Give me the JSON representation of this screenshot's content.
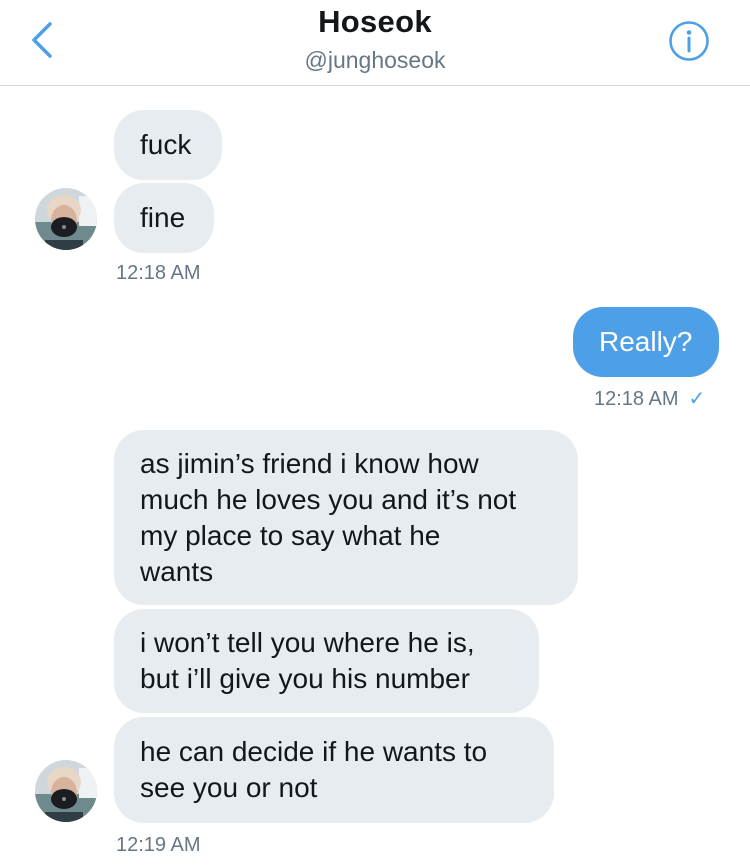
{
  "header": {
    "name": "Hoseok",
    "handle": "@junghoseok"
  },
  "colors": {
    "accent": "#4da0e8",
    "incoming_bubble": "#e6ecf0",
    "timestamp": "#657786"
  },
  "messages": {
    "group1": {
      "bubbles": [
        "fuck",
        "fine"
      ],
      "time": "12:18 AM"
    },
    "group2": {
      "bubbles": [
        "Really?"
      ],
      "time": "12:18 AM",
      "status": "✓"
    },
    "group3": {
      "bubbles": [
        [
          "as jimin’s friend i know how",
          "much he loves you and it’s not",
          "my place to say what he",
          "wants"
        ],
        [
          "i won’t tell you where he is,",
          "but i’ll give you his number"
        ],
        [
          "he can decide if he wants to",
          "see you or not"
        ]
      ],
      "time": "12:19 AM"
    }
  },
  "icons": {
    "back": "chevron-left-icon",
    "info": "info-icon"
  }
}
